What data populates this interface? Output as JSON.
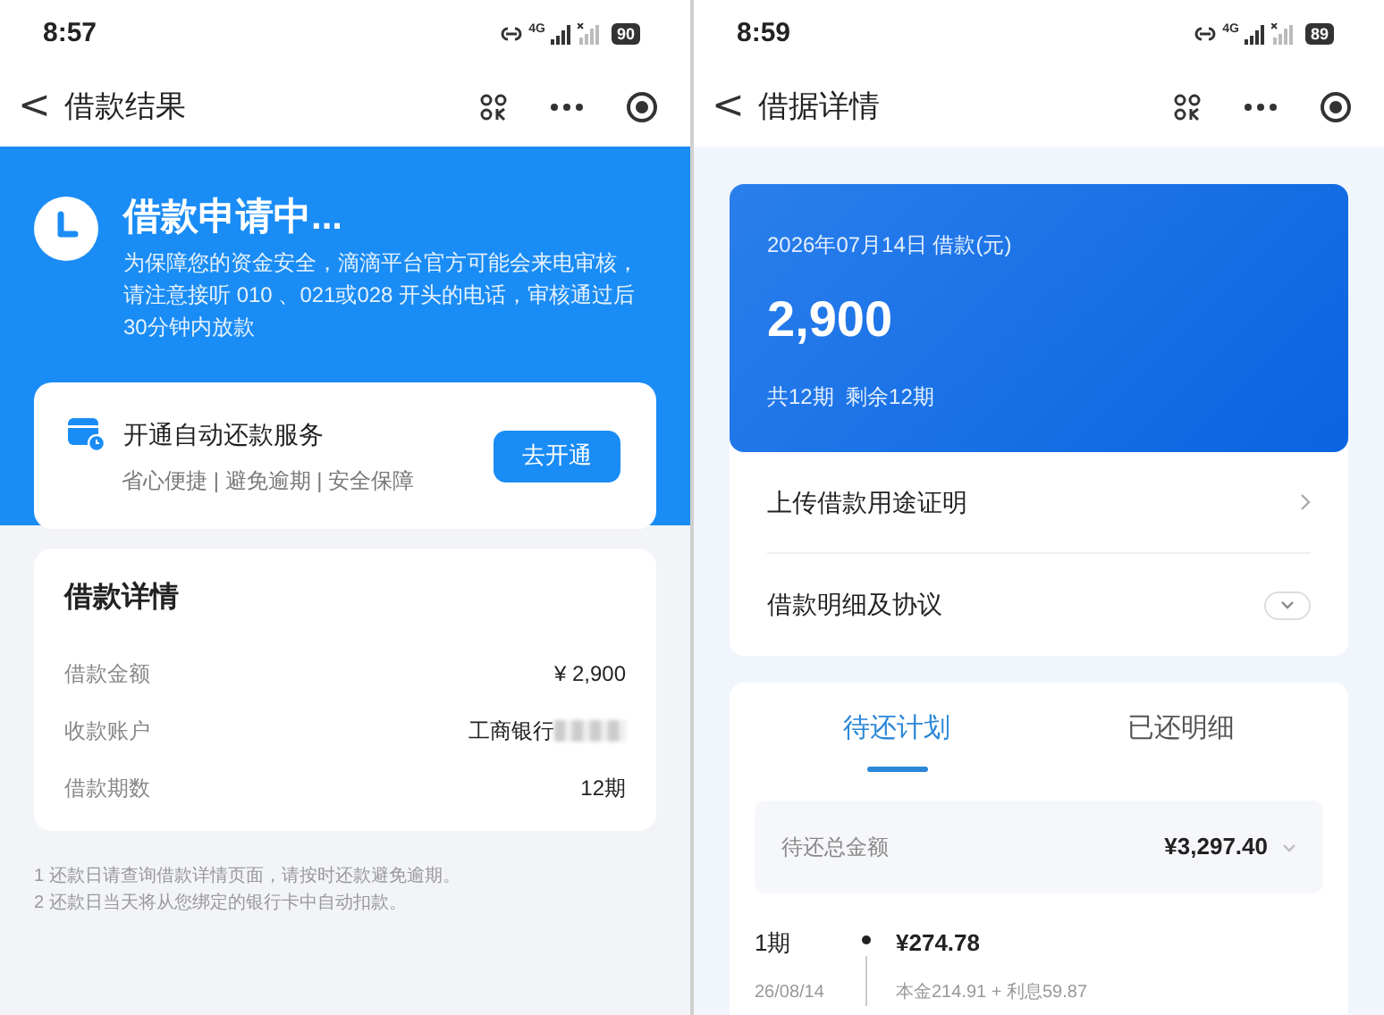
{
  "screens": [
    {
      "status_bar": {
        "time": "8:57",
        "network": "4G",
        "battery": "90"
      },
      "nav": {
        "back": "<",
        "title": "借款结果"
      }
    },
    {
      "status_bar": {
        "time": "8:59",
        "network": "4G",
        "battery": "89"
      },
      "nav": {
        "back": "<",
        "title": "借据详情"
      }
    }
  ],
  "result": {
    "title": "借款申请中...",
    "message": "为保障您的资金安全，滴滴平台官方可能会来电审核，请注意接听 010 、021或028 开头的电话，审核通过后30分钟内放款",
    "autopay": {
      "title": "开通自动还款服务",
      "subtitle": "省心便捷 | 避免逾期 | 安全保障",
      "button": "去开通"
    },
    "details": {
      "title": "借款详情",
      "rows": [
        {
          "label": "借款金额",
          "value": "¥ 2,900",
          "masked": false
        },
        {
          "label": "收款账户",
          "value": "工商银行",
          "masked": true
        },
        {
          "label": "借款期数",
          "value": "12期",
          "masked": false
        }
      ]
    },
    "notes": [
      "1 还款日请查询借款详情页面，请按时还款避免逾期。",
      "2 还款日当天将从您绑定的银行卡中自动扣款。"
    ]
  },
  "receipt": {
    "date_label": "2026年07月14日 借款(元)",
    "amount": "2,900",
    "terms": "共12期  剩余12期",
    "links": [
      {
        "label": "上传借款用途证明",
        "kind": "chevron"
      },
      {
        "label": "借款明细及协议",
        "kind": "expand"
      }
    ],
    "tabs": [
      {
        "label": "待还计划",
        "selected": true
      },
      {
        "label": "已还明细",
        "selected": false
      }
    ],
    "total": {
      "label": "待还总金额",
      "value": "¥3,297.40"
    },
    "installments": [
      {
        "period": "1期",
        "date": "26/08/14",
        "amount": "¥274.78",
        "breakdown": "本金214.91 + 利息59.87"
      }
    ]
  }
}
